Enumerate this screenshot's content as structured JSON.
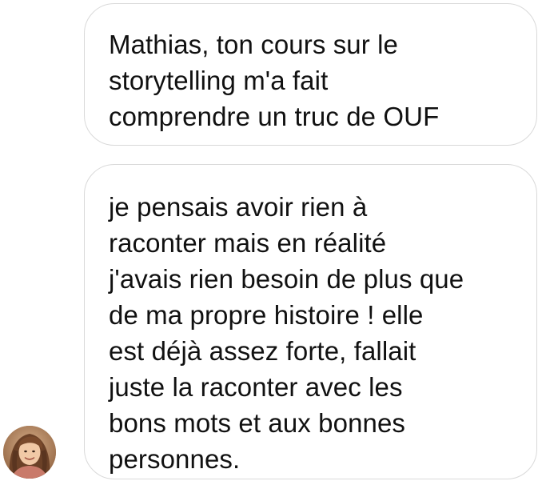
{
  "conversation": {
    "messages": [
      {
        "text": "Mathias, ton cours sur le\nstorytelling m'a fait\ncomprendre un truc de OUF"
      },
      {
        "text": "je pensais avoir rien à\nraconter mais en réalité\nj'avais rien besoin de plus que\nde ma propre histoire ! elle\nest déjà assez forte, fallait\njuste la raconter avec les\nbons mots et aux bonnes\npersonnes."
      }
    ],
    "sender_avatar_icon": "user-photo-avatar"
  },
  "colors": {
    "background": "#ffffff",
    "bubble_border": "#d9d9d9",
    "text": "#111111"
  }
}
